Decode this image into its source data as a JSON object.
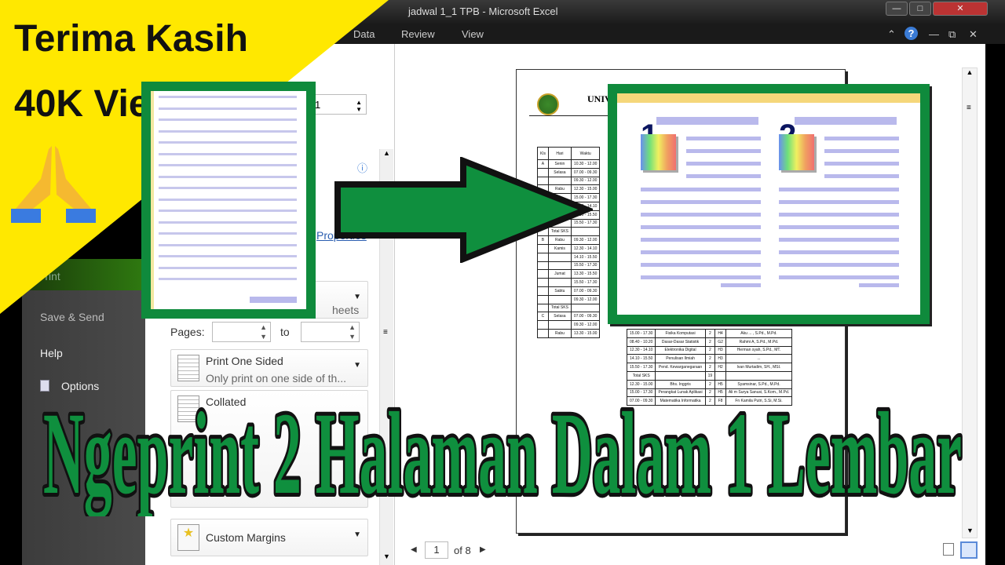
{
  "window": {
    "title": "jadwal 1_1 TPB  -  Microsoft Excel",
    "controls": [
      "minimize",
      "maximize",
      "close"
    ]
  },
  "ribbon": {
    "tabs": [
      "Data",
      "Review",
      "View"
    ]
  },
  "backstage": {
    "items": [
      "Print",
      "Save & Send",
      "Help",
      "Options"
    ]
  },
  "print_panel": {
    "copies_value": "1",
    "printer_properties_link": "Properties",
    "print_what_suffix": "heets",
    "pages_label": "Pages:",
    "to_label": "to",
    "sides": {
      "title": "Print One Sided",
      "subtitle": "Only print on one side of th..."
    },
    "collation": {
      "title": "Collated"
    },
    "margins": {
      "title": "Custom Margins"
    }
  },
  "preview": {
    "page_header": "UNIV",
    "table_headers": [
      "Kls",
      "Hari",
      "Waktu"
    ],
    "rows": [
      [
        "A",
        "Senin",
        "10.30 - 12.00"
      ],
      [
        "",
        "Selasa",
        "07.00 - 09.30"
      ],
      [
        "",
        "",
        "09.30 - 12.00"
      ],
      [
        "",
        "Rabu",
        "12.30 - 15.00"
      ],
      [
        "",
        "",
        "15.00 - 17.30"
      ],
      [
        "",
        "",
        "12.30 - 14.10"
      ],
      [
        "",
        "",
        "14.10 - 15.50"
      ],
      [
        "",
        "",
        "15.50 - 17.30"
      ],
      [
        "",
        "Total SKS",
        ""
      ],
      [
        "B",
        "Rabu",
        "09.30 - 12.00"
      ],
      [
        "",
        "Kamis",
        "12.30 - 14.10"
      ],
      [
        "",
        "",
        "14.10 - 15.50"
      ],
      [
        "",
        "",
        "15.50 - 17.30"
      ],
      [
        "",
        "Jumat",
        "13.30 - 15.50"
      ],
      [
        "",
        "",
        "15.50 - 17.30"
      ],
      [
        "",
        "Sabtu",
        "07.00 - 09.30"
      ],
      [
        "",
        "",
        "09.30 - 12.00"
      ],
      [
        "",
        "Total SKS",
        ""
      ],
      [
        "C",
        "Selasa",
        "07.00 - 09.30"
      ],
      [
        "",
        "",
        "09.30 - 12.00"
      ],
      [
        "",
        "Rabu",
        "13.30 - 15.00"
      ]
    ],
    "lower_rows": [
      [
        "15.00 - 17.30",
        "Fisika Komputasi",
        "2",
        "H4",
        "Aku ... , S.Pd., M.Pd."
      ],
      [
        "08.40 - 10.20",
        "Dasar-Dasar Statistik",
        "2",
        "G2",
        "Rahmi A, S.Pd., M.Pd."
      ],
      [
        "12.30 - 14.10",
        "Elektronika Digital",
        "2",
        "H3",
        "Herman syah, S.Pd., MT."
      ],
      [
        "14.10 - 15.50",
        "Penulisan Ilmiah",
        "2",
        "H3",
        "..."
      ],
      [
        "15.50 - 17.30",
        "Pend. Kewarganegaraan",
        "2",
        "H2",
        "Ivan Murtadim, SH., MSI."
      ],
      [
        "Total SKS",
        "",
        "19",
        "",
        ""
      ],
      [
        "12.30 - 15.00",
        "Bhs. Inggris",
        "2",
        "H5",
        "Syamsinar, S.Pd., M.Pd."
      ],
      [
        "15.00 - 17.30",
        "Perangkat Lunak Aplikasi",
        "2",
        "H5",
        "Ali m Surya Sanusi, S.Kom., M.Pd."
      ],
      [
        "07.00 - 09.30",
        "Matematika Informatika",
        "2",
        "F8",
        "Fn Kamila Putri, S.Si, M.Si."
      ]
    ],
    "page_current": "1",
    "page_total_label": "of 8"
  },
  "overlay": {
    "thanks_line1": "Terima Kasih",
    "thanks_line2": "40K Views",
    "emoji": "praying-hands-icon",
    "icon_page_numbers": [
      "1",
      "2"
    ],
    "headline": "Ngeprint 2 Halaman Dalam 1 Lembar",
    "colors": {
      "yellow": "#ffe800",
      "green": "#0f8f3e",
      "line": "#b9b9ec"
    }
  }
}
